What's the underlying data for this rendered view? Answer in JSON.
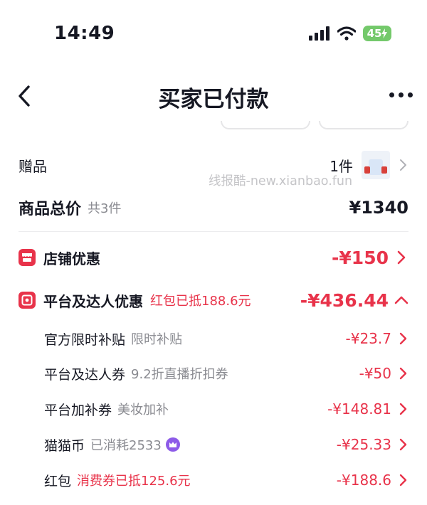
{
  "status_bar": {
    "time": "14:49",
    "battery": "45"
  },
  "nav": {
    "title": "买家已付款"
  },
  "gift": {
    "label": "赠品",
    "count": "1件"
  },
  "watermark": "线报酷-new.xianbao.fun",
  "total": {
    "label": "商品总价",
    "sub": "共3件",
    "value": "¥1340"
  },
  "shop_discount": {
    "label": "店铺优惠",
    "amount": "-¥150"
  },
  "platform_discount": {
    "label": "平台及达人优惠",
    "sub": "红包已抵188.6元",
    "amount": "-¥436.44"
  },
  "items": [
    {
      "label": "官方限时补贴",
      "sub": "限时补贴",
      "amount": "-¥23.7"
    },
    {
      "label": "平台及达人券",
      "sub": "9.2折直播折扣券",
      "amount": "-¥50"
    },
    {
      "label": "平台加补券",
      "sub": "美妆加补",
      "amount": "-¥148.81"
    },
    {
      "label": "猫猫币",
      "sub": "已消耗2533",
      "amount": "-¥25.33"
    },
    {
      "label": "红包",
      "sub": "消费券已抵125.6元",
      "amount": "-¥188.6"
    }
  ],
  "colors": {
    "accent_red": "#e8334a",
    "text": "#161823",
    "muted": "#8a8b91",
    "coin": "#8d5be8",
    "battery": "#74c96b"
  }
}
